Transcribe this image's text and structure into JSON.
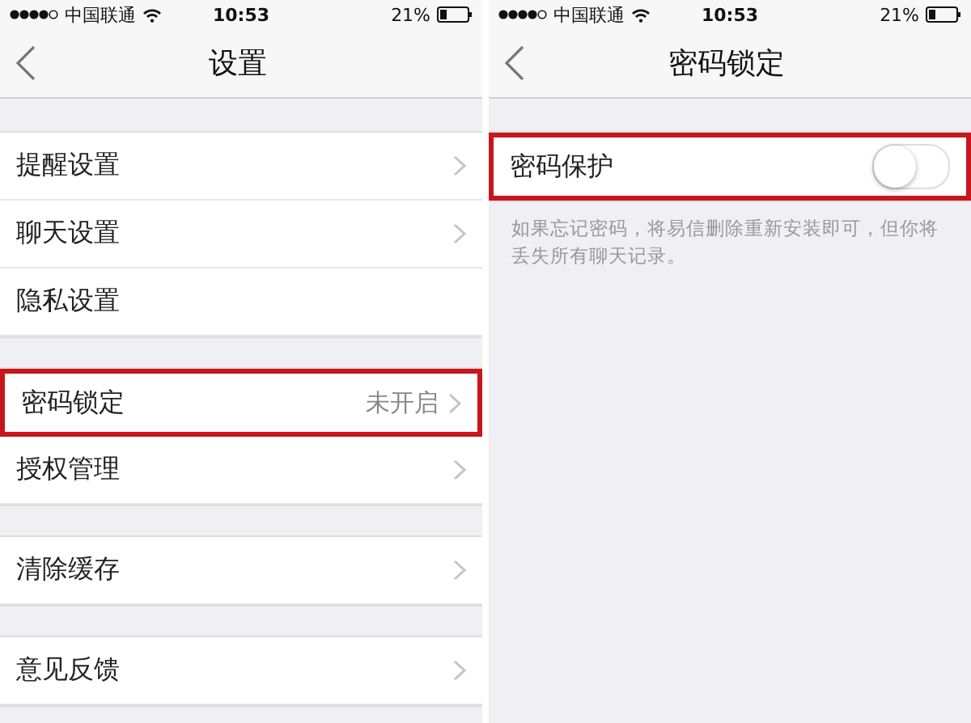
{
  "screens": [
    {
      "status_bar": {
        "carrier": "中国联通",
        "time": "10:53",
        "battery": "21%"
      },
      "title": "设置",
      "groups": [
        {
          "rows": [
            {
              "label": "提醒设置",
              "chevron": true,
              "highlighted": false
            },
            {
              "label": "聊天设置",
              "chevron": true,
              "highlighted": false
            },
            {
              "label": "隐私设置",
              "chevron": false,
              "highlighted": false
            }
          ]
        },
        {
          "rows": [
            {
              "label": "密码锁定",
              "value": "未开启",
              "chevron": true,
              "highlighted": true
            },
            {
              "label": "授权管理",
              "chevron": true,
              "highlighted": false
            }
          ]
        },
        {
          "rows": [
            {
              "label": "清除缓存",
              "chevron": true,
              "highlighted": false
            }
          ]
        },
        {
          "rows": [
            {
              "label": "意见反馈",
              "chevron": true,
              "highlighted": false
            }
          ]
        }
      ]
    },
    {
      "status_bar": {
        "carrier": "中国联通",
        "time": "10:53",
        "battery": "21%"
      },
      "title": "密码锁定",
      "toggle": {
        "label": "密码保护",
        "on": false,
        "highlighted": true
      },
      "note": "如果忘记密码，将易信删除重新安装即可，但你将丢失所有聊天记录。"
    }
  ]
}
